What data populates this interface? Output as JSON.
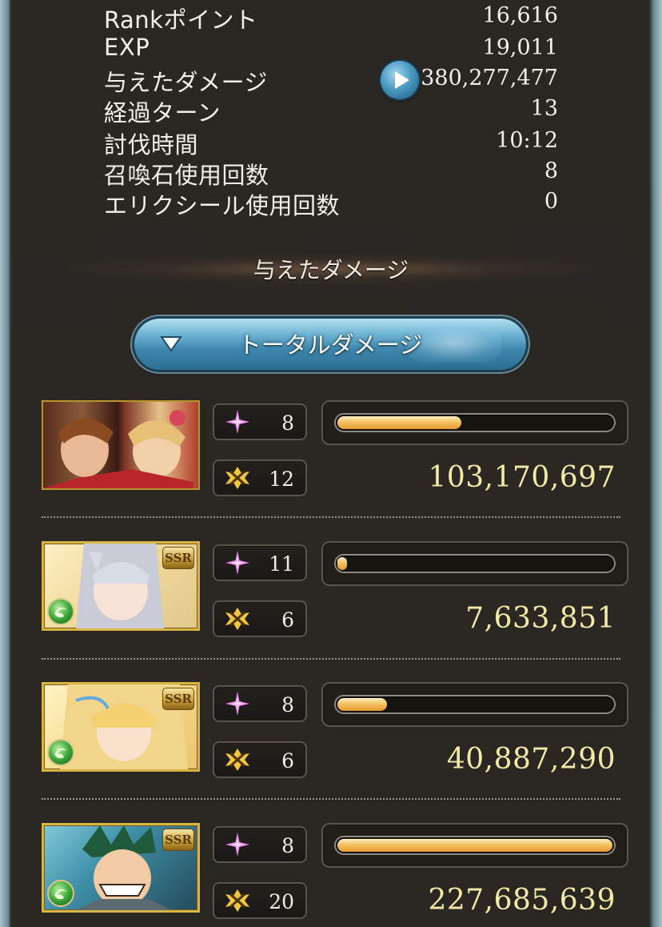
{
  "stats": [
    {
      "label": "Rankポイント",
      "value": "16,616"
    },
    {
      "label": "EXP",
      "value": "19,011"
    },
    {
      "label": "与えたダメージ",
      "value": "380,277,477"
    },
    {
      "label": "経過ターン",
      "value": "13"
    },
    {
      "label": "討伐時間",
      "value": "10:12"
    },
    {
      "label": "召喚石使用回数",
      "value": "8"
    },
    {
      "label": "エリクシール使用回数",
      "value": "0"
    }
  ],
  "section_title": "与えたダメージ",
  "dropdown": {
    "label": "トータルダメージ"
  },
  "characters": [
    {
      "rarity": "",
      "element": "",
      "skill_count": "8",
      "ca_count": "12",
      "damage": "103,170,697",
      "bar_fraction": 0.45
    },
    {
      "rarity": "SSR",
      "element": "wind",
      "skill_count": "11",
      "ca_count": "6",
      "damage": "7,633,851",
      "bar_fraction": 0.034
    },
    {
      "rarity": "SSR",
      "element": "wind",
      "skill_count": "8",
      "ca_count": "6",
      "damage": "40,887,290",
      "bar_fraction": 0.18
    },
    {
      "rarity": "SSR",
      "element": "wind",
      "skill_count": "8",
      "ca_count": "20",
      "damage": "227,685,639",
      "bar_fraction": 1.0
    }
  ],
  "colors": {
    "bar": "#f0b24a",
    "damage_text": "#f3eaa8",
    "button": "#3f87ad"
  },
  "icons": {
    "skill": "sparkle-icon",
    "charge_attack": "crossed-swords-icon",
    "play": "play-icon",
    "dropdown": "triangle-down-icon",
    "element": "wind-element-icon"
  }
}
